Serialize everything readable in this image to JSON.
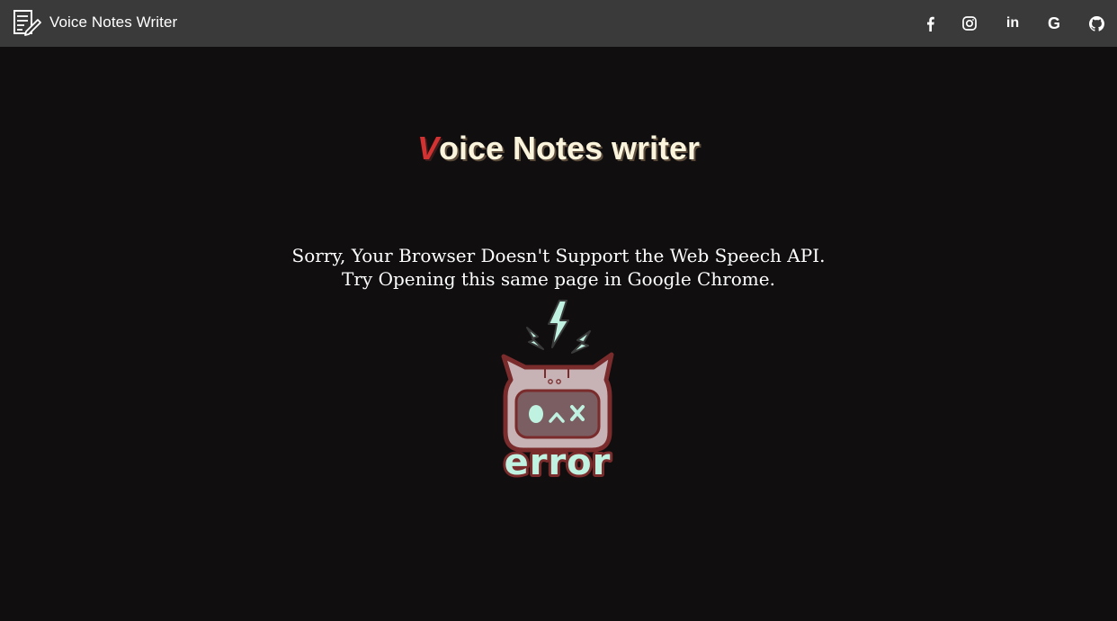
{
  "navbar": {
    "brand_icon": "notes-pen-icon",
    "brand_title": "Voice Notes Writer",
    "social_links": [
      {
        "icon": "facebook-icon"
      },
      {
        "icon": "instagram-icon"
      },
      {
        "icon": "linkedin-icon",
        "glyph": "in"
      },
      {
        "icon": "google-icon",
        "glyph": "G"
      },
      {
        "icon": "github-icon"
      }
    ]
  },
  "main": {
    "title_first_letter": "V",
    "title_rest": "oice Notes writer",
    "message_line1": "Sorry, Your Browser Doesn't Support the Web Speech API.",
    "message_line2": "Try Opening this same page in Google Chrome.",
    "error_image_text": "error"
  },
  "colors": {
    "navbar_bg": "#3a3a3a",
    "page_bg": "#100e0f",
    "title_accent": "#d23232",
    "title_text": "#fbf4dc",
    "error_mint": "#bff2e0",
    "error_outline": "#7a2b2b"
  }
}
